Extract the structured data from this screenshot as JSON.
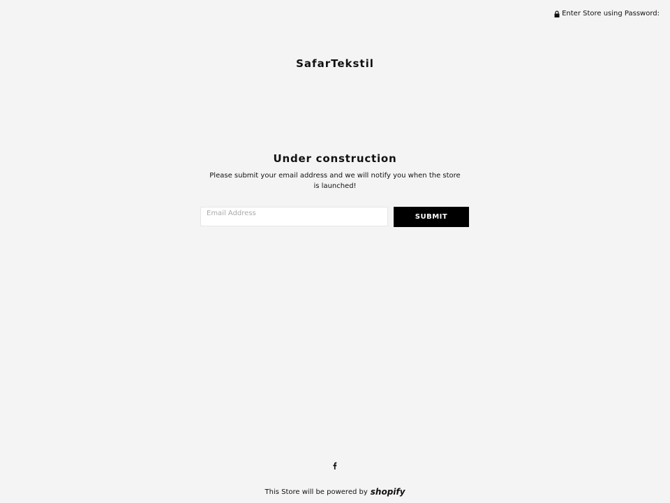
{
  "header": {
    "password_link": "Enter Store using Password:",
    "lock_icon": "lock-icon"
  },
  "store": {
    "title": "SafarTekstil"
  },
  "notice": {
    "heading": "Under construction",
    "text": "Please submit your email address and we will notify you when the store is launched!"
  },
  "signup": {
    "email_placeholder": "Email Address",
    "email_value": "",
    "submit_label": "SUBMIT"
  },
  "social": {
    "icons": [
      "facebook-icon"
    ]
  },
  "footer": {
    "powered_by": "This Store will be powered by",
    "platform": "shopify"
  },
  "colors": {
    "background": "#f4f4f4",
    "button": "#000000",
    "button_text": "#ffffff",
    "text": "#111111"
  }
}
